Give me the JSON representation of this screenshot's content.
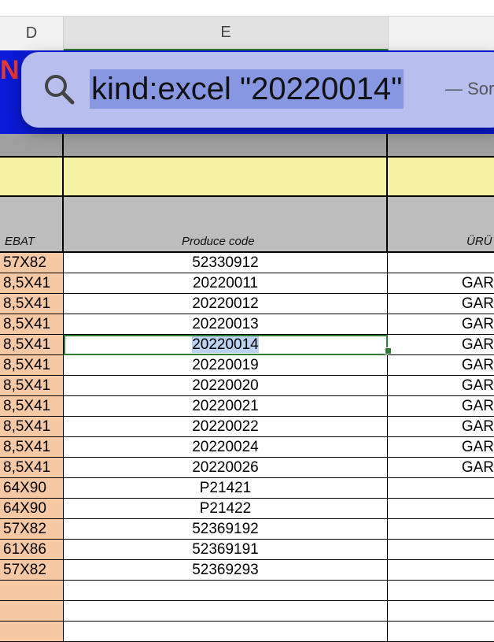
{
  "columns": {
    "d": "D",
    "e": "E",
    "f": ""
  },
  "background_fragment": "N",
  "header_row": {
    "d": "EBAT",
    "e": "Produce code",
    "f": "ÜRÜ"
  },
  "rows": [
    {
      "d": "57X82",
      "e": "52330912",
      "f": ""
    },
    {
      "d": "8,5X41",
      "e": "20220011",
      "f": "GAR"
    },
    {
      "d": "8,5X41",
      "e": "20220012",
      "f": "GAR"
    },
    {
      "d": "8,5X41",
      "e": "20220013",
      "f": "GAR"
    },
    {
      "d": "8,5X41",
      "e": "20220014",
      "f": "GAR"
    },
    {
      "d": "8,5X41",
      "e": "20220019",
      "f": "GAR"
    },
    {
      "d": "8,5X41",
      "e": "20220020",
      "f": "GAR"
    },
    {
      "d": "8,5X41",
      "e": "20220021",
      "f": "GAR"
    },
    {
      "d": "8,5X41",
      "e": "20220022",
      "f": "GAR"
    },
    {
      "d": "8,5X41",
      "e": "20220024",
      "f": "GAR"
    },
    {
      "d": "8,5X41",
      "e": "20220026",
      "f": "GAR"
    },
    {
      "d": "64X90",
      "e": "P21421",
      "f": ""
    },
    {
      "d": "64X90",
      "e": "P21422",
      "f": ""
    },
    {
      "d": "57X82",
      "e": "52369192",
      "f": ""
    },
    {
      "d": "61X86",
      "e": "52369191",
      "f": ""
    },
    {
      "d": "57X82",
      "e": "52369293",
      "f": ""
    },
    {
      "d": "",
      "e": "",
      "f": ""
    },
    {
      "d": "",
      "e": "",
      "f": ""
    },
    {
      "d": "",
      "e": "",
      "f": ""
    }
  ],
  "selected_value": "20220014",
  "spotlight": {
    "query": "kind:excel \"20220014\"",
    "suffix": "— Sor",
    "icon": "search-icon"
  },
  "colors": {
    "accent_green": "#2e7d32",
    "band_blue": "#0a1ad6",
    "cell_peach": "#f6c9a4",
    "header_yellow": "#f5f3a3"
  }
}
